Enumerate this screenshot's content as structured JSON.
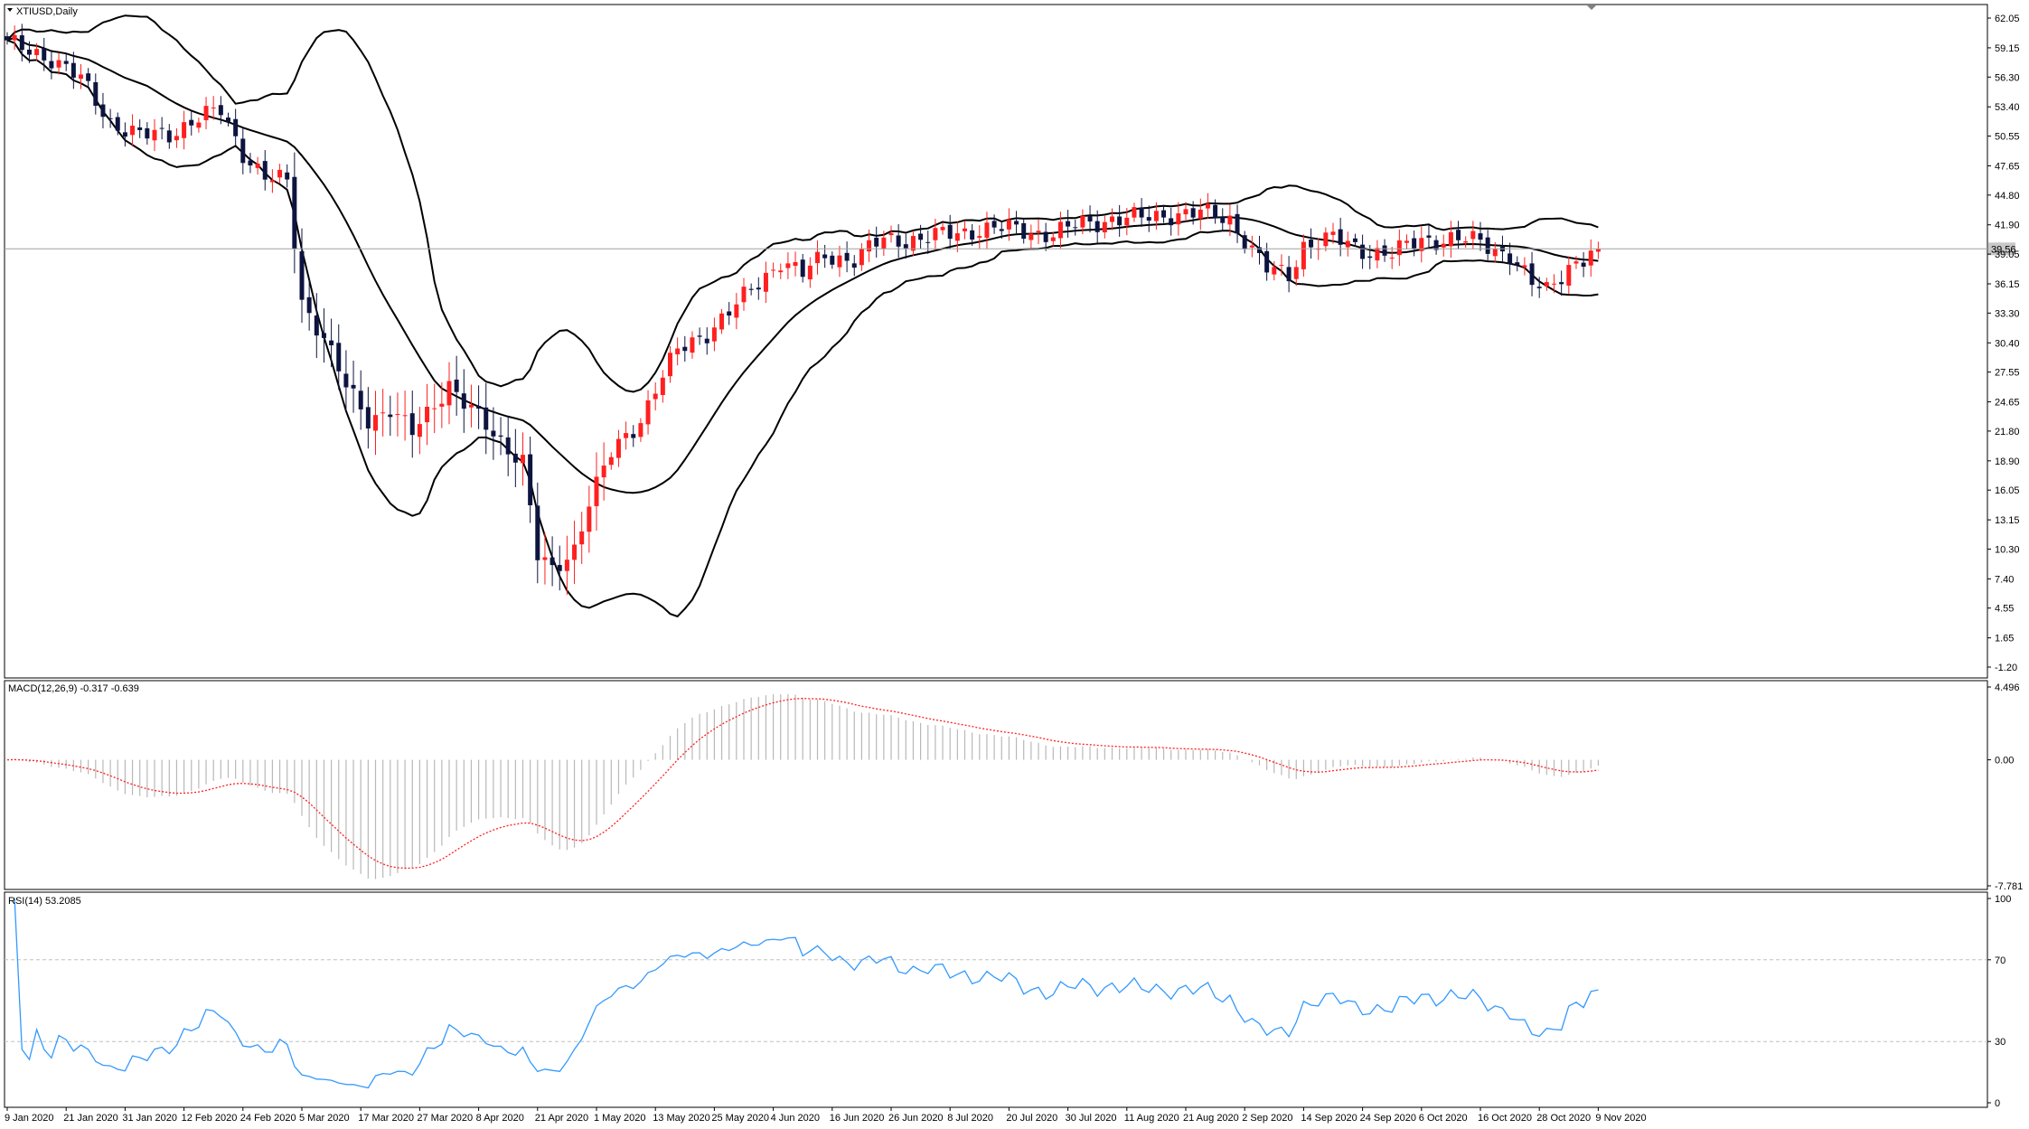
{
  "window": {
    "title": "XTIUSD,Daily",
    "price_tag": "39.56"
  },
  "colors": {
    "bull": "#ff2020",
    "bear": "#0d1440",
    "band": "#000000",
    "macd_hist": "#b8b8b8",
    "macd_signal": "#ff2020",
    "rsi": "#3399ff",
    "level": "#c0c0c0",
    "price_line": "#a0a0a0",
    "tag_bg": "#c8c8c8"
  },
  "chart_data": [
    {
      "type": "candlestick",
      "title": "XTIUSD,Daily",
      "y_ticks": [
        "62.05",
        "59.15",
        "56.30",
        "53.40",
        "50.55",
        "47.65",
        "44.80",
        "41.90",
        "39.05",
        "36.15",
        "33.30",
        "30.40",
        "27.55",
        "24.65",
        "21.80",
        "18.90",
        "16.05",
        "13.15",
        "10.30",
        "7.40",
        "4.55",
        "1.65",
        "-1.20"
      ],
      "ylim": [
        -1.2,
        62.05
      ],
      "last_price": 39.56,
      "x_labels": [
        "9 Jan 2020",
        "21 Jan 2020",
        "31 Jan 2020",
        "12 Feb 2020",
        "24 Feb 2020",
        "5 Mar 2020",
        "17 Mar 2020",
        "27 Mar 2020",
        "8 Apr 2020",
        "21 Apr 2020",
        "1 May 2020",
        "13 May 2020",
        "25 May 2020",
        "4 Jun 2020",
        "16 Jun 2020",
        "26 Jun 2020",
        "8 Jul 2020",
        "20 Jul 2020",
        "30 Jul 2020",
        "11 Aug 2020",
        "21 Aug 2020",
        "2 Sep 2020",
        "14 Sep 2020",
        "24 Sep 2020",
        "6 Oct 2020",
        "16 Oct 2020",
        "28 Oct 2020",
        "9 Nov 2020"
      ],
      "x_label_bar_index": [
        0,
        8,
        16,
        24,
        32,
        40,
        48,
        56,
        64,
        72,
        80,
        88,
        96,
        104,
        112,
        120,
        128,
        136,
        144,
        152,
        160,
        168,
        176,
        184,
        192,
        200,
        208,
        216
      ],
      "close_anchors": [
        [
          0,
          59.5
        ],
        [
          6,
          58.2
        ],
        [
          10,
          56.0
        ],
        [
          14,
          52.0
        ],
        [
          18,
          50.5
        ],
        [
          22,
          50.8
        ],
        [
          25,
          52.0
        ],
        [
          29,
          53.0
        ],
        [
          32,
          49.0
        ],
        [
          35,
          46.5
        ],
        [
          38,
          46.0
        ],
        [
          40,
          34.5
        ],
        [
          43,
          31.0
        ],
        [
          46,
          26.0
        ],
        [
          49,
          23.0
        ],
        [
          52,
          24.0
        ],
        [
          55,
          21.5
        ],
        [
          58,
          24.5
        ],
        [
          60,
          26.5
        ],
        [
          62,
          24.5
        ],
        [
          66,
          21.5
        ],
        [
          70,
          19.0
        ],
        [
          72,
          9.5
        ],
        [
          74,
          8.0
        ],
        [
          77,
          10.5
        ],
        [
          79,
          15.0
        ],
        [
          82,
          19.5
        ],
        [
          86,
          23.0
        ],
        [
          88,
          26.0
        ],
        [
          91,
          29.5
        ],
        [
          95,
          31.5
        ],
        [
          99,
          34.0
        ],
        [
          103,
          37.0
        ],
        [
          105,
          38.5
        ],
        [
          108,
          37.0
        ],
        [
          111,
          39.0
        ],
        [
          115,
          38.5
        ],
        [
          119,
          40.5
        ],
        [
          124,
          40.5
        ],
        [
          128,
          41.0
        ],
        [
          132,
          41.5
        ],
        [
          136,
          41.5
        ],
        [
          142,
          41.0
        ],
        [
          146,
          42.0
        ],
        [
          150,
          42.5
        ],
        [
          154,
          42.5
        ],
        [
          158,
          43.0
        ],
        [
          162,
          43.0
        ],
        [
          166,
          42.5
        ],
        [
          168,
          40.5
        ],
        [
          171,
          37.5
        ],
        [
          174,
          37.0
        ],
        [
          176,
          40.0
        ],
        [
          180,
          40.5
        ],
        [
          184,
          39.5
        ],
        [
          188,
          39.0
        ],
        [
          192,
          40.5
        ],
        [
          196,
          40.5
        ],
        [
          200,
          40.2
        ],
        [
          204,
          39.0
        ],
        [
          207,
          36.0
        ],
        [
          209,
          35.5
        ],
        [
          212,
          38.0
        ],
        [
          214,
          38.5
        ],
        [
          216,
          39.56
        ]
      ],
      "ma_period": 20,
      "band_mult": 2
    },
    {
      "type": "histogram_line",
      "title": "MACD(12,26,9) -0.317 -0.639",
      "y_ticks": [
        "4.496",
        "0.00",
        "-7.781"
      ],
      "ylim": [
        -7.781,
        4.496
      ]
    },
    {
      "type": "line",
      "title": "RSI(14) 53.2085",
      "y_ticks": [
        "100",
        "70",
        "30",
        "0"
      ],
      "ylim": [
        0,
        100
      ],
      "levels": [
        70,
        30
      ],
      "period": 14
    }
  ]
}
